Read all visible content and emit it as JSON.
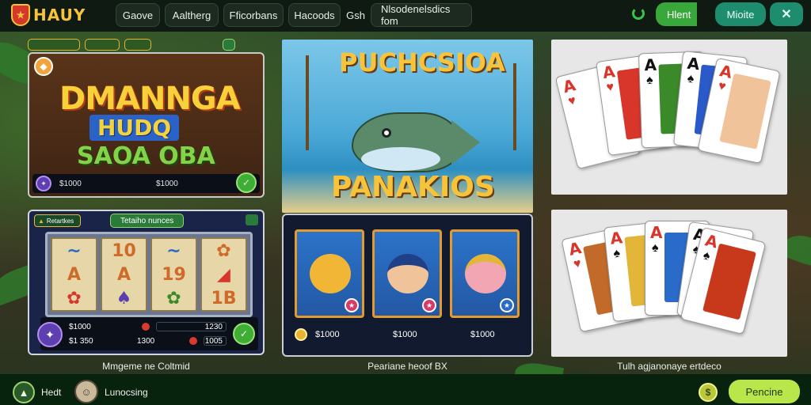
{
  "header": {
    "logo": "HAUY",
    "tabs": [
      {
        "label": "Gaove"
      },
      {
        "label": "Aaltherg"
      },
      {
        "label": "Fficorbans"
      },
      {
        "label": "Hacoods"
      },
      {
        "label": "Gsh"
      },
      {
        "label": "Nlsodenelsdics fom"
      }
    ],
    "btn_green": "Hlent",
    "btn_teal": "Mioite",
    "btn_close": "✕"
  },
  "games": [
    {
      "pills": [
        "",
        "",
        "",
        ""
      ],
      "title": "DMANNGA",
      "title2": "HUDQ",
      "subtitle": "SAOA OBA",
      "footer_left": "$1000",
      "footer_mid": "$1000"
    },
    {
      "tag_left": "Retartkes",
      "tag_mid": "Tetaiho nunces",
      "tag_right": "",
      "reels": [
        [
          "~",
          "A",
          "✿"
        ],
        [
          "10",
          "A",
          "♠"
        ],
        [
          "~",
          "19",
          "✿"
        ],
        [
          "✿",
          "◢",
          "1B"
        ]
      ],
      "stat1_label": "$1000",
      "stat1_value": "1230",
      "stat2_label": "$1 350",
      "stat2_mid": "1300",
      "stat2_value": "1005",
      "caption": "Mmgeme ne Coltmid"
    },
    {
      "title_top": "PUCHCSIOA",
      "title_bot": "PANAKIOS"
    },
    {
      "foot1": "$1000",
      "foot2": "$1000",
      "foot3": "$1000",
      "caption": "Peariane heoof BX"
    },
    {
      "ranks": [
        "A",
        "A",
        "A",
        "A",
        "A"
      ]
    },
    {
      "ranks": [
        "A",
        "A",
        "A",
        "A",
        "A"
      ],
      "caption": "Tulh agjanonaye ertdeco"
    }
  ],
  "footer": {
    "left_label": "Hedt",
    "center_label": "Lunocsing",
    "button": "Pencine"
  },
  "colors": {
    "accent": "#f6c33b",
    "green": "#38a83a",
    "teal": "#1e8d6e"
  }
}
